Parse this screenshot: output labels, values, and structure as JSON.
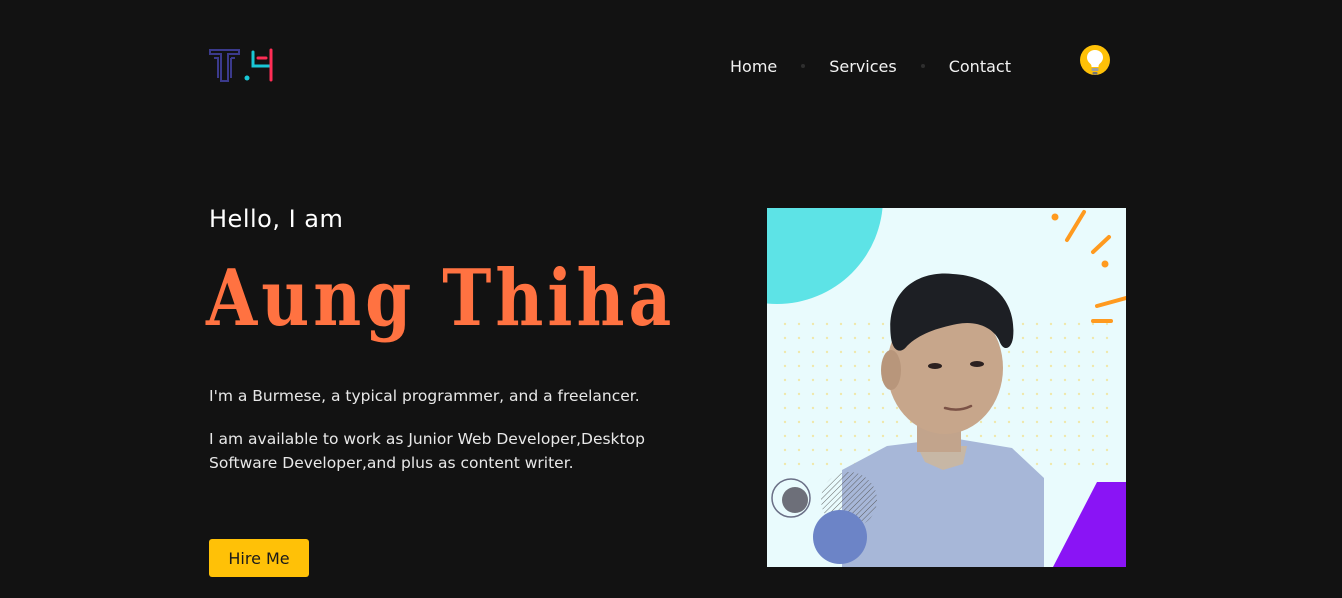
{
  "header": {
    "logo_icon": "th-monogram-logo",
    "nav": [
      {
        "label": "Home"
      },
      {
        "label": "Services"
      },
      {
        "label": "Contact"
      }
    ],
    "theme_toggle_icon": "lightbulb-icon"
  },
  "hero": {
    "greeting": "Hello, I am",
    "name": "Aung Thiha",
    "description_1": "I'm a Burmese, a typical programmer, and a freelancer.",
    "description_2": "I am available to work as Junior Web Developer,Desktop Software Developer,and plus as content writer.",
    "hire_label": "Hire Me",
    "photo_icon": "profile-photo"
  },
  "colors": {
    "background": "#121212",
    "accent_name": "#ff7241",
    "button": "#ffc107",
    "bulb": "#ffc107"
  }
}
